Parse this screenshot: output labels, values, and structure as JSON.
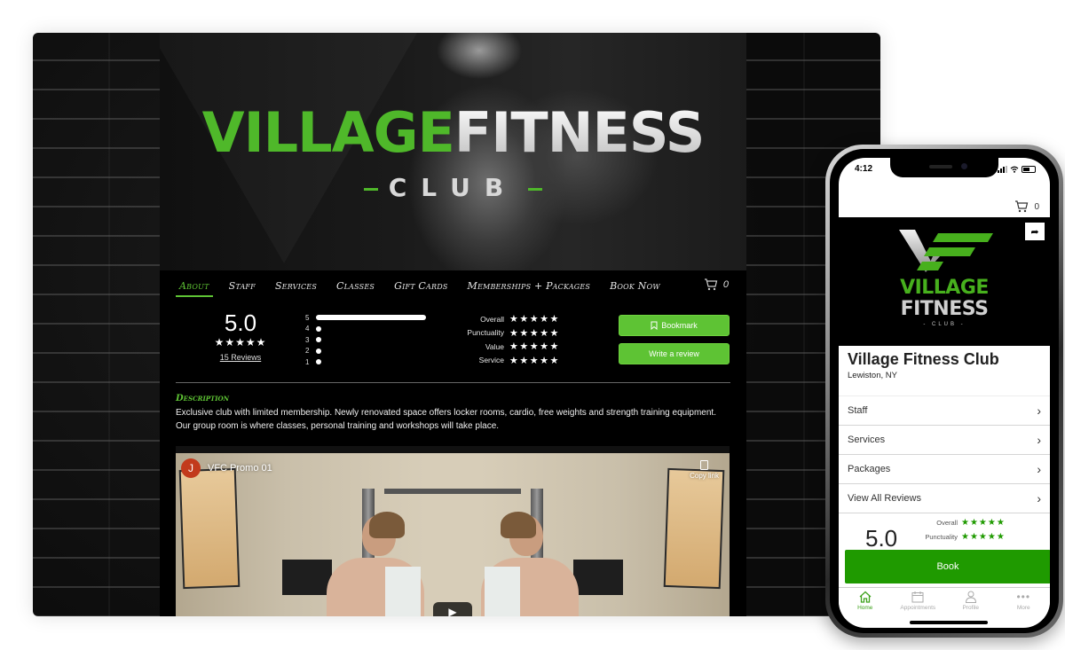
{
  "desktop": {
    "hero": {
      "title_green": "VILLAGE",
      "title_white": "FITNESS",
      "subtitle": "CLUB"
    },
    "nav": {
      "items": [
        {
          "label": "About",
          "active": true
        },
        {
          "label": "Staff"
        },
        {
          "label": "Services"
        },
        {
          "label": "Classes"
        },
        {
          "label": "Gift Cards"
        },
        {
          "label": "Memberships + Packages"
        },
        {
          "label": "Book Now"
        }
      ],
      "cart_count": "0"
    },
    "ratings": {
      "overall_score": "5.0",
      "overall_stars": "★★★★★",
      "reviews_link": "15 Reviews",
      "distribution": [
        {
          "label": "5",
          "fraction": 1.0
        },
        {
          "label": "4",
          "fraction": 0
        },
        {
          "label": "3",
          "fraction": 0
        },
        {
          "label": "2",
          "fraction": 0
        },
        {
          "label": "1",
          "fraction": 0
        }
      ],
      "categories": [
        {
          "label": "Overall",
          "stars": "★★★★★"
        },
        {
          "label": "Punctuality",
          "stars": "★★★★★"
        },
        {
          "label": "Value",
          "stars": "★★★★★"
        },
        {
          "label": "Service",
          "stars": "★★★★★"
        }
      ],
      "bookmark_label": "Bookmark",
      "write_review_label": "Write a review"
    },
    "description": {
      "heading": "Description",
      "text": "Exclusive club with limited membership. Newly renovated space offers locker rooms, cardio, free weights and strength training equipment. Our group room is where classes, personal training and workshops will take place."
    },
    "video": {
      "channel_initial": "J",
      "title": "VFC Promo 01",
      "copy_link_label": "Copy link",
      "play_icon": "▶"
    }
  },
  "mobile": {
    "status": {
      "time": "4:12"
    },
    "cart_count": "0",
    "banner": {
      "line1": "VILLAGE",
      "line2": "FITNESS",
      "line3": "- CLUB -"
    },
    "business_name": "Village Fitness Club",
    "location": "Lewiston, NY",
    "menu": [
      {
        "label": "Staff"
      },
      {
        "label": "Services"
      },
      {
        "label": "Packages"
      },
      {
        "label": "View All Reviews"
      }
    ],
    "rating": {
      "score": "5.0",
      "rows": [
        {
          "label": "Overall",
          "stars": "★★★★★"
        },
        {
          "label": "Punctuality",
          "stars": "★★★★★"
        }
      ]
    },
    "book_label": "Book",
    "tabs": [
      {
        "label": "Home",
        "icon": "home-icon",
        "active": true
      },
      {
        "label": "Appointments",
        "icon": "calendar-icon"
      },
      {
        "label": "Profile",
        "icon": "user-icon"
      },
      {
        "label": "More",
        "icon": "more-icon"
      }
    ]
  },
  "colors": {
    "accent_green": "#5ec334",
    "mobile_green": "#1f9a00"
  }
}
